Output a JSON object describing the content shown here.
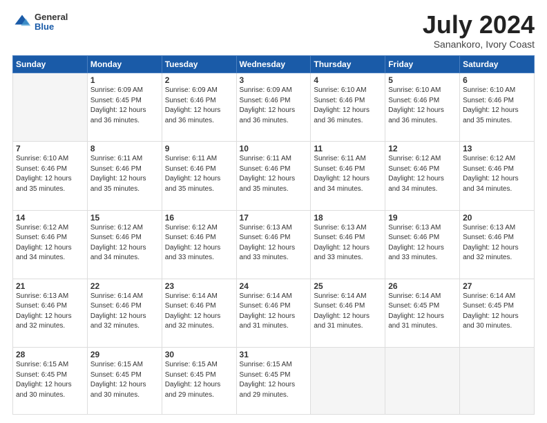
{
  "header": {
    "logo_general": "General",
    "logo_blue": "Blue",
    "month_year": "July 2024",
    "location": "Sanankoro, Ivory Coast"
  },
  "days_of_week": [
    "Sunday",
    "Monday",
    "Tuesday",
    "Wednesday",
    "Thursday",
    "Friday",
    "Saturday"
  ],
  "weeks": [
    [
      {
        "day": "",
        "info": ""
      },
      {
        "day": "1",
        "info": "Sunrise: 6:09 AM\nSunset: 6:45 PM\nDaylight: 12 hours\nand 36 minutes."
      },
      {
        "day": "2",
        "info": "Sunrise: 6:09 AM\nSunset: 6:46 PM\nDaylight: 12 hours\nand 36 minutes."
      },
      {
        "day": "3",
        "info": "Sunrise: 6:09 AM\nSunset: 6:46 PM\nDaylight: 12 hours\nand 36 minutes."
      },
      {
        "day": "4",
        "info": "Sunrise: 6:10 AM\nSunset: 6:46 PM\nDaylight: 12 hours\nand 36 minutes."
      },
      {
        "day": "5",
        "info": "Sunrise: 6:10 AM\nSunset: 6:46 PM\nDaylight: 12 hours\nand 36 minutes."
      },
      {
        "day": "6",
        "info": "Sunrise: 6:10 AM\nSunset: 6:46 PM\nDaylight: 12 hours\nand 35 minutes."
      }
    ],
    [
      {
        "day": "7",
        "info": "Sunrise: 6:10 AM\nSunset: 6:46 PM\nDaylight: 12 hours\nand 35 minutes."
      },
      {
        "day": "8",
        "info": "Sunrise: 6:11 AM\nSunset: 6:46 PM\nDaylight: 12 hours\nand 35 minutes."
      },
      {
        "day": "9",
        "info": "Sunrise: 6:11 AM\nSunset: 6:46 PM\nDaylight: 12 hours\nand 35 minutes."
      },
      {
        "day": "10",
        "info": "Sunrise: 6:11 AM\nSunset: 6:46 PM\nDaylight: 12 hours\nand 35 minutes."
      },
      {
        "day": "11",
        "info": "Sunrise: 6:11 AM\nSunset: 6:46 PM\nDaylight: 12 hours\nand 34 minutes."
      },
      {
        "day": "12",
        "info": "Sunrise: 6:12 AM\nSunset: 6:46 PM\nDaylight: 12 hours\nand 34 minutes."
      },
      {
        "day": "13",
        "info": "Sunrise: 6:12 AM\nSunset: 6:46 PM\nDaylight: 12 hours\nand 34 minutes."
      }
    ],
    [
      {
        "day": "14",
        "info": "Sunrise: 6:12 AM\nSunset: 6:46 PM\nDaylight: 12 hours\nand 34 minutes."
      },
      {
        "day": "15",
        "info": "Sunrise: 6:12 AM\nSunset: 6:46 PM\nDaylight: 12 hours\nand 34 minutes."
      },
      {
        "day": "16",
        "info": "Sunrise: 6:12 AM\nSunset: 6:46 PM\nDaylight: 12 hours\nand 33 minutes."
      },
      {
        "day": "17",
        "info": "Sunrise: 6:13 AM\nSunset: 6:46 PM\nDaylight: 12 hours\nand 33 minutes."
      },
      {
        "day": "18",
        "info": "Sunrise: 6:13 AM\nSunset: 6:46 PM\nDaylight: 12 hours\nand 33 minutes."
      },
      {
        "day": "19",
        "info": "Sunrise: 6:13 AM\nSunset: 6:46 PM\nDaylight: 12 hours\nand 33 minutes."
      },
      {
        "day": "20",
        "info": "Sunrise: 6:13 AM\nSunset: 6:46 PM\nDaylight: 12 hours\nand 32 minutes."
      }
    ],
    [
      {
        "day": "21",
        "info": "Sunrise: 6:13 AM\nSunset: 6:46 PM\nDaylight: 12 hours\nand 32 minutes."
      },
      {
        "day": "22",
        "info": "Sunrise: 6:14 AM\nSunset: 6:46 PM\nDaylight: 12 hours\nand 32 minutes."
      },
      {
        "day": "23",
        "info": "Sunrise: 6:14 AM\nSunset: 6:46 PM\nDaylight: 12 hours\nand 32 minutes."
      },
      {
        "day": "24",
        "info": "Sunrise: 6:14 AM\nSunset: 6:46 PM\nDaylight: 12 hours\nand 31 minutes."
      },
      {
        "day": "25",
        "info": "Sunrise: 6:14 AM\nSunset: 6:46 PM\nDaylight: 12 hours\nand 31 minutes."
      },
      {
        "day": "26",
        "info": "Sunrise: 6:14 AM\nSunset: 6:45 PM\nDaylight: 12 hours\nand 31 minutes."
      },
      {
        "day": "27",
        "info": "Sunrise: 6:14 AM\nSunset: 6:45 PM\nDaylight: 12 hours\nand 30 minutes."
      }
    ],
    [
      {
        "day": "28",
        "info": "Sunrise: 6:15 AM\nSunset: 6:45 PM\nDaylight: 12 hours\nand 30 minutes."
      },
      {
        "day": "29",
        "info": "Sunrise: 6:15 AM\nSunset: 6:45 PM\nDaylight: 12 hours\nand 30 minutes."
      },
      {
        "day": "30",
        "info": "Sunrise: 6:15 AM\nSunset: 6:45 PM\nDaylight: 12 hours\nand 29 minutes."
      },
      {
        "day": "31",
        "info": "Sunrise: 6:15 AM\nSunset: 6:45 PM\nDaylight: 12 hours\nand 29 minutes."
      },
      {
        "day": "",
        "info": ""
      },
      {
        "day": "",
        "info": ""
      },
      {
        "day": "",
        "info": ""
      }
    ]
  ]
}
